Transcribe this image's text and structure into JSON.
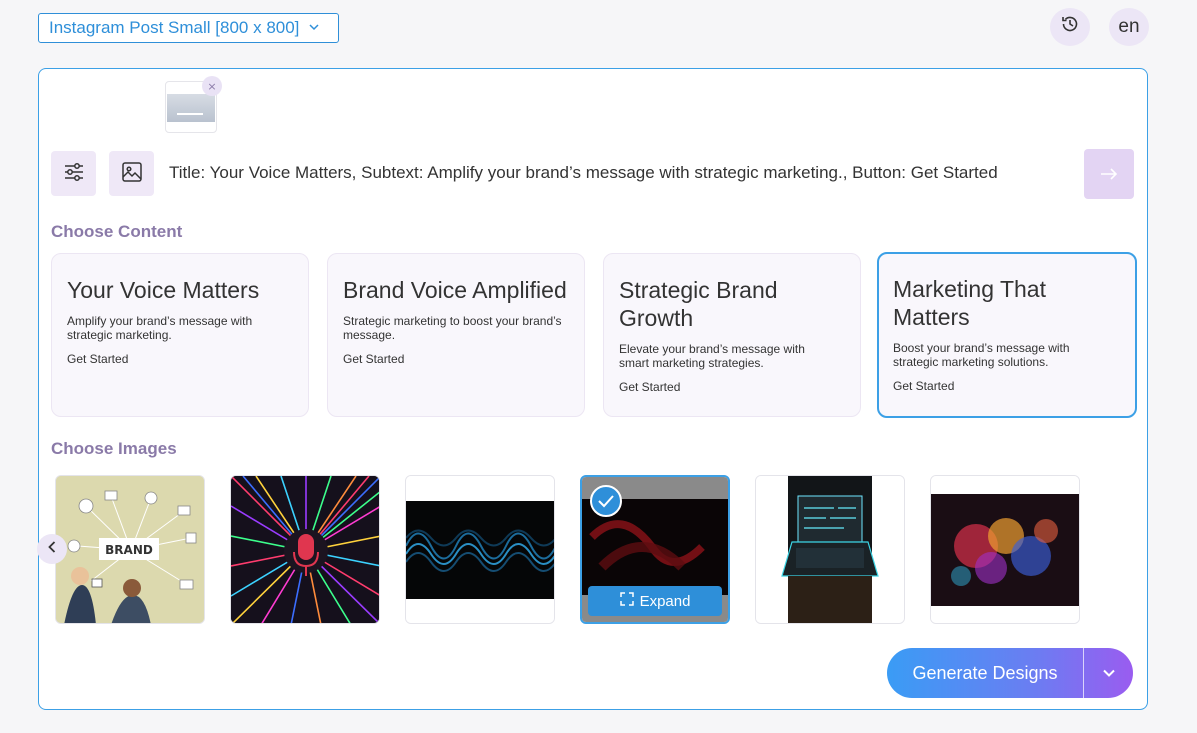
{
  "header": {
    "size_select": "Instagram Post Small [800 x 800]",
    "history_icon": "history-icon",
    "language": "en"
  },
  "composer": {
    "attachment_remove": "×",
    "prompt": "Title: Your Voice Matters, Subtext: Amplify your brand’s message with strategic marketing., Button: Get Started",
    "send_icon": "arrow-right-icon"
  },
  "content": {
    "label": "Choose Content",
    "cards": [
      {
        "title": "Your Voice Matters",
        "sub": "Amplify your brand’s message with strategic marketing.",
        "cta": "Get Started"
      },
      {
        "title": "Brand Voice Amplified",
        "sub": "Strategic marketing to boost your brand’s message.",
        "cta": "Get Started"
      },
      {
        "title": "Strategic Brand Growth",
        "sub": "Elevate your brand’s message with smart marketing strategies.",
        "cta": "Get Started"
      },
      {
        "title": "Marketing That Matters",
        "sub": "Boost your brand’s message with strategic marketing solutions.",
        "cta": "Get Started"
      }
    ],
    "selected_index": 3
  },
  "images": {
    "label": "Choose Images",
    "brand_text": "BRAND",
    "expand_label": "Expand",
    "selected_index": 3
  },
  "actions": {
    "generate_label": "Generate Designs"
  },
  "colors": {
    "accent": "#2e8fd9",
    "lavender": "#efe8f7",
    "label_purple": "#8a7aa8"
  }
}
